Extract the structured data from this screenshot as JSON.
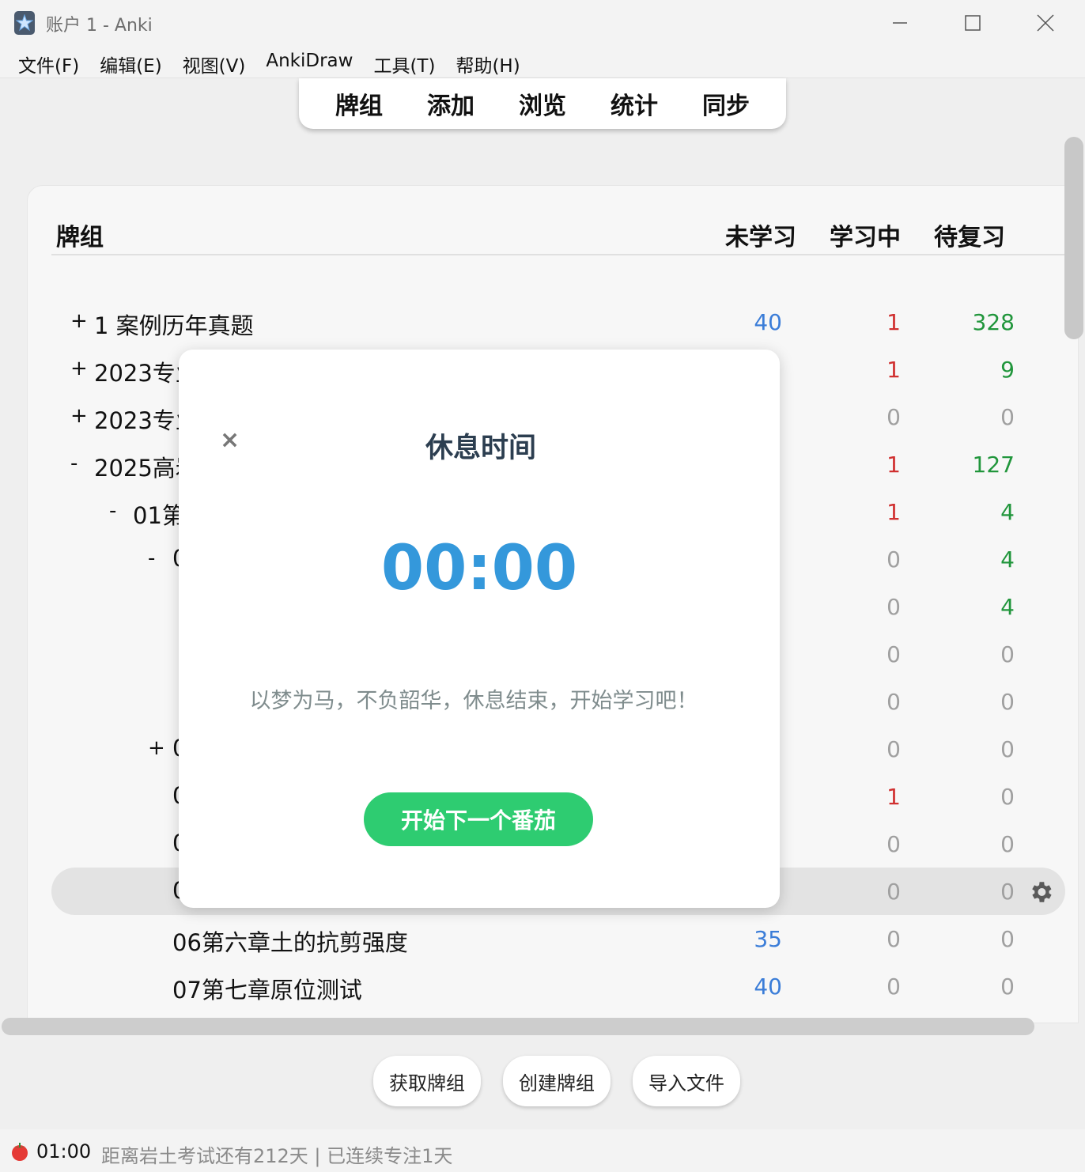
{
  "window": {
    "title": "账户 1 - Anki"
  },
  "menu": [
    "文件(F)",
    "编辑(E)",
    "视图(V)",
    "AnkiDraw",
    "工具(T)",
    "帮助(H)"
  ],
  "toolbar": [
    "牌组",
    "添加",
    "浏览",
    "统计",
    "同步"
  ],
  "deck_table": {
    "headers": {
      "name": "牌组",
      "new": "未学习",
      "learning": "学习中",
      "due": "待复习"
    },
    "rows": [
      {
        "expander": "+",
        "name": "1 案例历年真题",
        "new": "40",
        "learning": "1",
        "due": "328"
      },
      {
        "expander": "+",
        "name": "2023专业",
        "new": "",
        "learning": "1",
        "due": "9"
      },
      {
        "expander": "+",
        "name": "2023专业",
        "new": "",
        "learning": "0",
        "due": "0"
      },
      {
        "expander": "-",
        "name": "2025高岩",
        "new": "",
        "learning": "1",
        "due": "127"
      },
      {
        "expander": "-",
        "name": "01第",
        "new": "",
        "learning": "1",
        "due": "4"
      },
      {
        "expander": "-",
        "name": "0",
        "new": "",
        "learning": "0",
        "due": "4"
      },
      {
        "expander": "",
        "name": "",
        "new": "",
        "learning": "0",
        "due": "4"
      },
      {
        "expander": "",
        "name": "",
        "new": "",
        "learning": "0",
        "due": "0"
      },
      {
        "expander": "",
        "name": "",
        "new": "",
        "learning": "0",
        "due": "0"
      },
      {
        "expander": "+",
        "name": "0",
        "new": "",
        "learning": "0",
        "due": "0"
      },
      {
        "expander": "",
        "name": "0",
        "new": "",
        "learning": "1",
        "due": "0"
      },
      {
        "expander": "",
        "name": "0",
        "new": "",
        "learning": "0",
        "due": "0"
      },
      {
        "expander": "",
        "name": "0",
        "new": "",
        "learning": "0",
        "due": "0"
      },
      {
        "expander": "",
        "name": "06第六章土的抗剪强度",
        "new": "35",
        "learning": "0",
        "due": "0"
      },
      {
        "expander": "",
        "name": "07第七章原位测试",
        "new": "40",
        "learning": "0",
        "due": "0"
      }
    ]
  },
  "bottom_buttons": [
    "获取牌组",
    "创建牌组",
    "导入文件"
  ],
  "status": {
    "timer": "01:00",
    "message": "距离岩土考试还有212天 | 已连续专注1天"
  },
  "modal": {
    "close": "×",
    "title": "休息时间",
    "time": "00:00",
    "message": "以梦为马，不负韶华，休息结束，开始学习吧！",
    "button": "开始下一个番茄"
  },
  "colors": {
    "new": "#3b7dd8",
    "learning": "#d03030",
    "due": "#21963c",
    "zero": "#a0a0a0",
    "timer": "#3498db",
    "button": "#2ecc71"
  }
}
